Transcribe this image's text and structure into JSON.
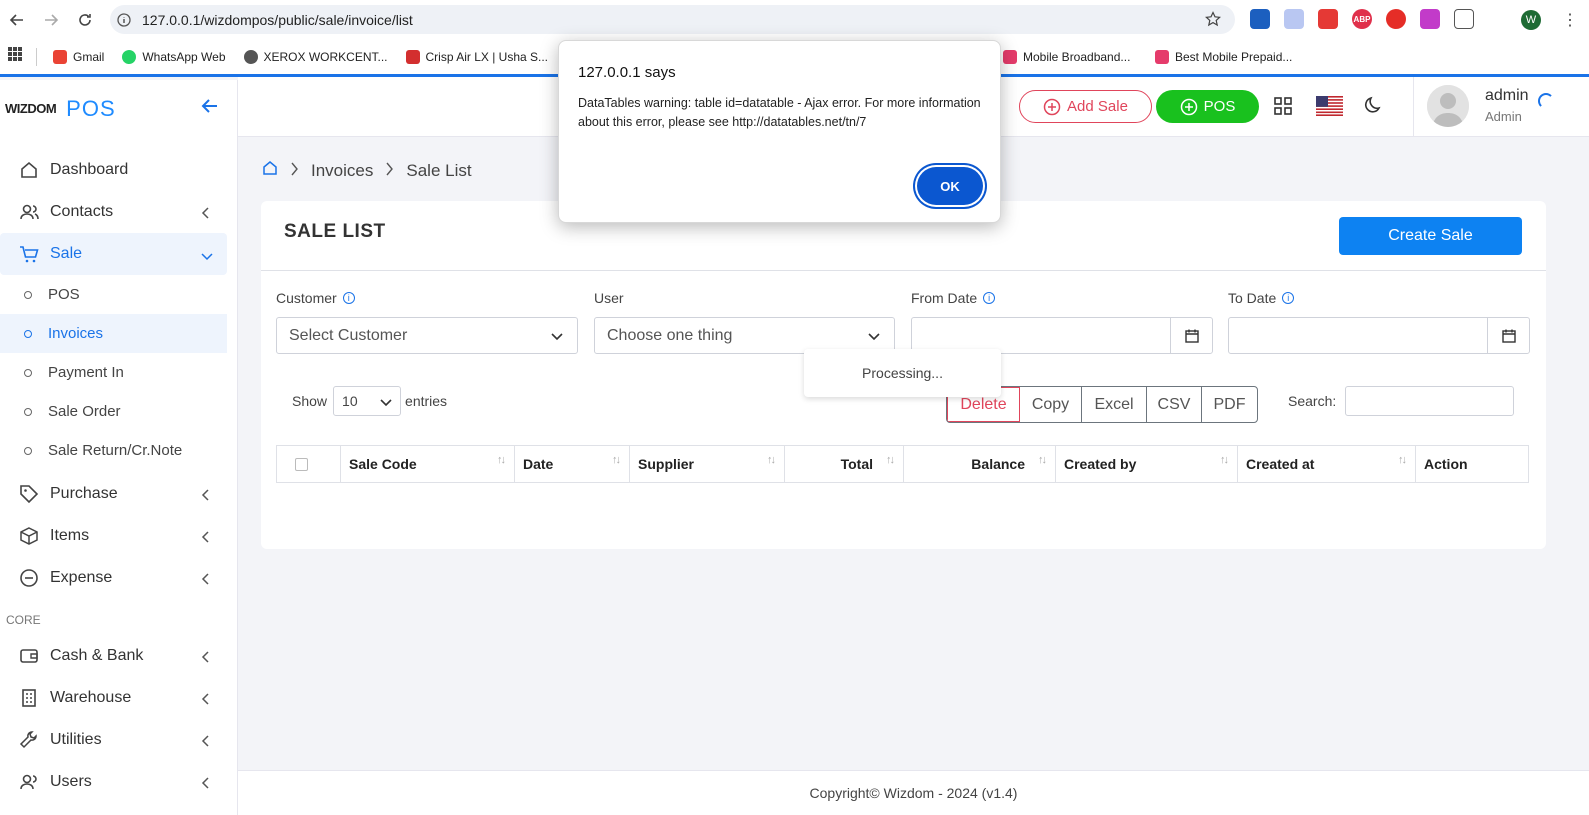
{
  "browser": {
    "url": "127.0.0.1/wizdompos/public/sale/invoice/list",
    "profile_letter": "W",
    "bookmarks": [
      {
        "label": "Gmail",
        "color": "#ea4335"
      },
      {
        "label": "WhatsApp Web",
        "color": "#25d366"
      },
      {
        "label": "XEROX WORKCENT...",
        "color": "#555555"
      },
      {
        "label": "Crisp Air LX | Usha S...",
        "color": "#d32f2f"
      },
      {
        "label": "",
        "color": "#d32f2f"
      }
    ],
    "bookmarks_right": [
      {
        "label": "Mobile Broadband...",
        "color": "#e53b6b"
      },
      {
        "label": "Best Mobile Prepaid...",
        "color": "#e53b6b"
      }
    ]
  },
  "sidebar": {
    "brand": "WIZDOM",
    "app": "POS",
    "items": [
      {
        "label": "Dashboard",
        "icon": "home-icon"
      },
      {
        "label": "Contacts",
        "icon": "users-icon"
      },
      {
        "label": "Sale",
        "icon": "cart-icon"
      }
    ],
    "sale_sub": [
      {
        "label": "POS"
      },
      {
        "label": "Invoices"
      },
      {
        "label": "Payment In"
      },
      {
        "label": "Sale Order"
      },
      {
        "label": "Sale Return/Cr.Note"
      }
    ],
    "items2": [
      {
        "label": "Purchase",
        "icon": "tag-icon"
      },
      {
        "label": "Items",
        "icon": "box-icon"
      },
      {
        "label": "Expense",
        "icon": "minus-circle-icon"
      }
    ],
    "section_core": "CORE",
    "items3": [
      {
        "label": "Cash & Bank",
        "icon": "wallet-icon"
      },
      {
        "label": "Warehouse",
        "icon": "building-icon"
      },
      {
        "label": "Utilities",
        "icon": "wrench-icon"
      },
      {
        "label": "Users",
        "icon": "users-icon"
      }
    ]
  },
  "topbar": {
    "add_sale": "Add Sale",
    "pos": "POS",
    "user_name": "admin",
    "user_role": "Admin"
  },
  "breadcrumb": {
    "level1": "Invoices",
    "level2": "Sale List"
  },
  "card": {
    "title": "SALE LIST",
    "create_button": "Create Sale",
    "filters": {
      "customer_label": "Customer",
      "customer_placeholder": "Select Customer",
      "user_label": "User",
      "user_placeholder": "Choose one thing",
      "from_label": "From Date",
      "to_label": "To Date"
    },
    "processing": "Processing...",
    "show_label": "Show",
    "show_value": "10",
    "entries_label": "entries",
    "buttons": [
      "Delete",
      "Copy",
      "Excel",
      "CSV",
      "PDF"
    ],
    "search_label": "Search:",
    "columns": [
      "Sale Code",
      "Date",
      "Supplier",
      "Total",
      "Balance",
      "Created by",
      "Created at",
      "Action"
    ]
  },
  "footer": "Copyright© Wizdom - 2024 (v1.4)",
  "dialog": {
    "title": "127.0.0.1 says",
    "message": "DataTables warning: table id=datatable - Ajax error. For more information about this error, please see http://datatables.net/tn/7",
    "ok": "OK"
  },
  "colors": {
    "accent": "#0d82f2",
    "danger": "#e0455b",
    "success": "#19c11e"
  }
}
